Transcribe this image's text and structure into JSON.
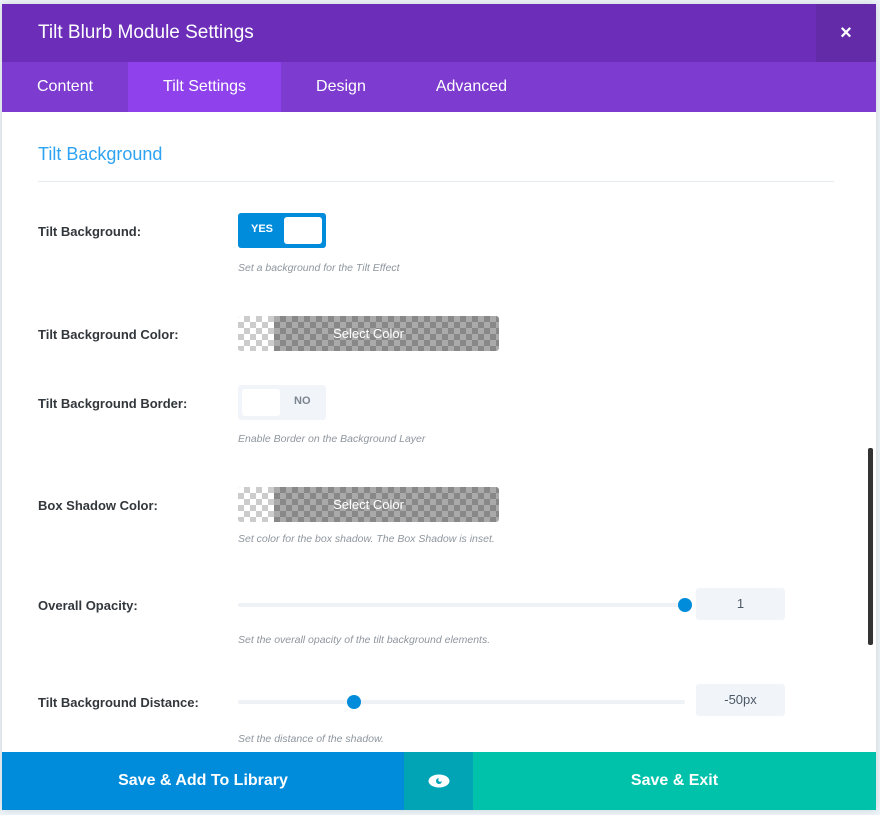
{
  "header": {
    "title": "Tilt Blurb Module Settings",
    "close": "×"
  },
  "tabs": [
    "Content",
    "Tilt Settings",
    "Design",
    "Advanced"
  ],
  "section": {
    "title": "Tilt Background"
  },
  "fields": {
    "tilt_background": {
      "label": "Tilt Background:",
      "value": "YES",
      "help": "Set a background for the Tilt Effect"
    },
    "bg_color": {
      "label": "Tilt Background Color:",
      "button": "Select Color"
    },
    "bg_border": {
      "label": "Tilt Background Border:",
      "value": "NO",
      "help": "Enable Border on the Background Layer"
    },
    "shadow_color": {
      "label": "Box Shadow Color:",
      "button": "Select Color",
      "help": "Set color for the box shadow. The Box Shadow is inset."
    },
    "opacity": {
      "label": "Overall Opacity:",
      "value": "1",
      "fraction": 1.0,
      "help": "Set the overall opacity of the tilt background elements."
    },
    "distance": {
      "label": "Tilt Background Distance:",
      "value": "-50px",
      "fraction": 0.26,
      "help": "Set the distance of the shadow."
    }
  },
  "footer": {
    "save_library": "Save & Add To Library",
    "save_exit": "Save & Exit"
  },
  "colors": {
    "header": "#6c2eb9",
    "tabs": "#7d3bcf",
    "blue": "#008bdb",
    "teal": "#00c1aa"
  }
}
